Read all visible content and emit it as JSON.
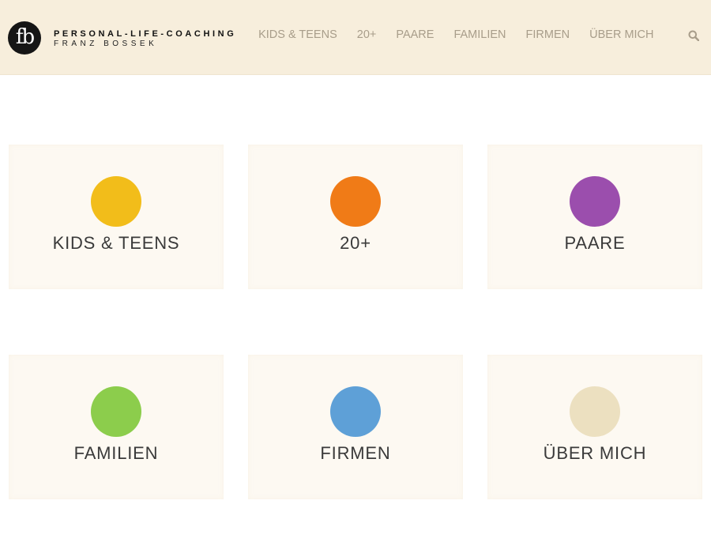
{
  "header": {
    "logo_text": "fb",
    "brand_name": "PERSONAL-LIFE-COACHING",
    "brand_sub": "FRANZ BOSSEK",
    "search_icon": "search-icon"
  },
  "nav": {
    "items": [
      {
        "label": "KIDS & TEENS"
      },
      {
        "label": "20+"
      },
      {
        "label": "PAARE"
      },
      {
        "label": "FAMILIEN"
      },
      {
        "label": "FIRMEN"
      },
      {
        "label": "ÜBER MICH"
      }
    ]
  },
  "tiles": [
    {
      "label": "KIDS & TEENS",
      "color": "#f2bd1a"
    },
    {
      "label": "20+",
      "color": "#f07b17"
    },
    {
      "label": "PAARE",
      "color": "#9b4ead"
    },
    {
      "label": "FAMILIEN",
      "color": "#8ccd4c"
    },
    {
      "label": "FIRMEN",
      "color": "#5ea0d7"
    },
    {
      "label": "ÜBER MICH",
      "color": "#ece0c0"
    }
  ],
  "colors": {
    "header_bg": "#f7eedc",
    "nav_text": "#a89d8a",
    "tile_bg": "#fdf9f2",
    "tile_text": "#3a3a3a"
  }
}
